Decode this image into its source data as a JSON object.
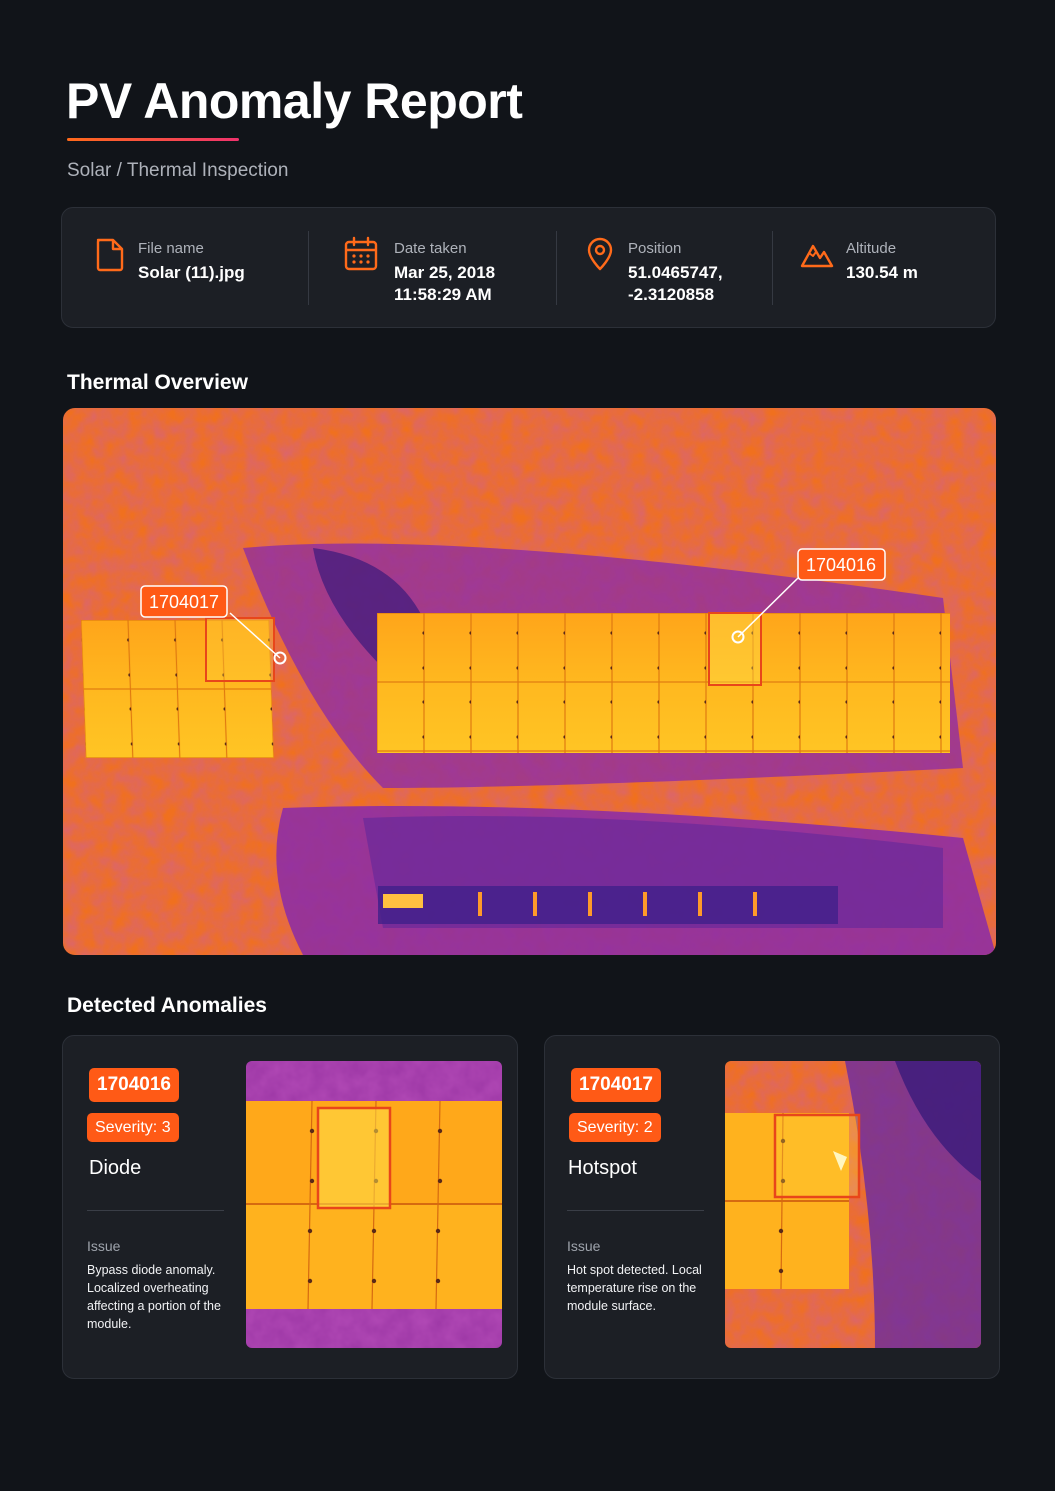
{
  "header": {
    "title": "PV Anomaly Report",
    "subtitle": "Solar / Thermal Inspection"
  },
  "meta": {
    "file_name": {
      "label": "File name",
      "value": "Solar (11).jpg",
      "icon": "file-icon"
    },
    "date_taken": {
      "label": "Date taken",
      "value_line1": "Mar 25, 2018",
      "value_line2": "11:58:29 AM",
      "icon": "calendar-icon"
    },
    "position": {
      "label": "Position",
      "value_line1": "51.0465747,",
      "value_line2": "-2.3120858",
      "icon": "location-pin-icon"
    },
    "altitude": {
      "label": "Altitude",
      "value": "130.54 m",
      "icon": "mountain-icon"
    }
  },
  "overview": {
    "title": "Thermal Overview",
    "markers": [
      "1704017",
      "1704016"
    ]
  },
  "anomalies_section": {
    "title": "Detected Anomalies",
    "items": [
      {
        "id": "1704016",
        "severity": "Severity: 3",
        "type": "Diode",
        "issue_label": "Issue",
        "issue_text": "Bypass diode anomaly. Localized overheating affecting a portion of the module."
      },
      {
        "id": "1704017",
        "severity": "Severity: 2",
        "type": "Hotspot",
        "issue_label": "Issue",
        "issue_text": "Hot spot detected. Local temperature rise on the module surface."
      }
    ]
  },
  "colors": {
    "accent": "#ff5a16",
    "background": "#111419",
    "card": "#1c1f25"
  }
}
